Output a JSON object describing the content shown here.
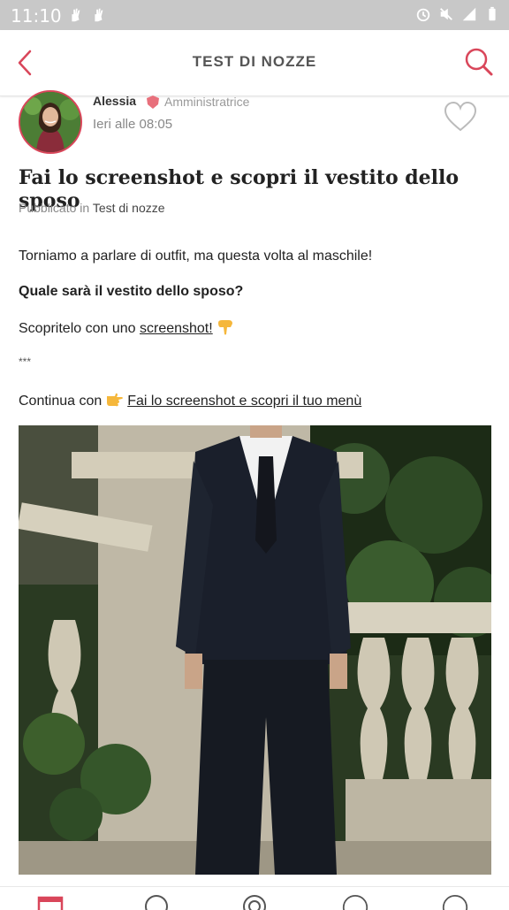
{
  "status_bar": {
    "time": "11:10",
    "left_icons": [
      "hand-icon",
      "hand-icon"
    ],
    "right_icons": [
      "alarm-icon",
      "mute-icon",
      "signal-icon",
      "battery-icon"
    ]
  },
  "header": {
    "title": "TEST DI NOZZE",
    "back_icon": "chevron-left-icon",
    "search_icon": "search-icon",
    "accent_color": "#d9465a"
  },
  "author": {
    "name": "Alessia",
    "role": "Amministratrice",
    "date": "Ieri alle 08:05"
  },
  "post": {
    "title": "Fai lo screenshot e scopri il vestito dello sposo",
    "published_prefix": "Pubblicato in",
    "published_in": "Test di nozze",
    "p1": "Torniamo a parlare di outfit, ma questa volta al maschile!",
    "p2": "Quale sarà il vestito dello sposo?",
    "p3_prefix": "Scopritelo con uno",
    "p3_link": "screenshot!",
    "p4": "***",
    "p5_prefix": "Continua con",
    "p5_link": "Fai lo screenshot e scopri il tuo menù"
  },
  "bottom_nav": {
    "icons": [
      "home-icon",
      "community-icon",
      "inspiration-icon",
      "chat-icon",
      "profile-icon"
    ]
  }
}
